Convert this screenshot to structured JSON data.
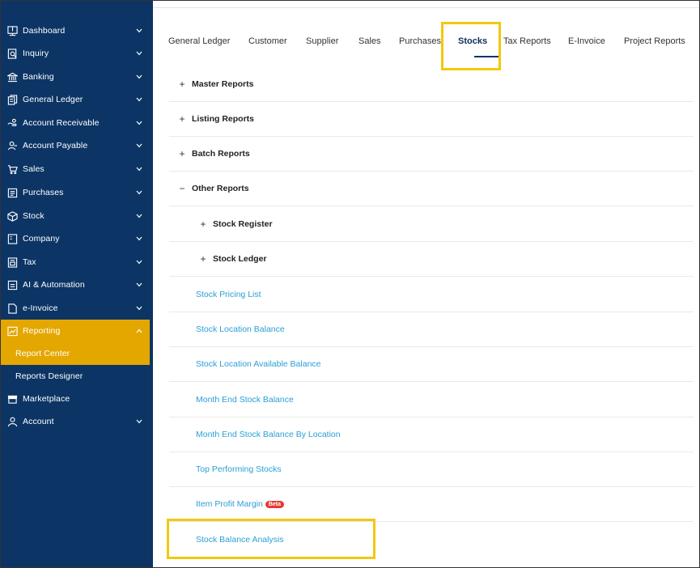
{
  "sidebar": {
    "items": [
      {
        "label": "Dashboard",
        "icon": "dashboard-icon",
        "chevron": true
      },
      {
        "label": "Inquiry",
        "icon": "inquiry-icon",
        "chevron": true
      },
      {
        "label": "Banking",
        "icon": "bank-icon",
        "chevron": true
      },
      {
        "label": "General Ledger",
        "icon": "ledger-icon",
        "chevron": true
      },
      {
        "label": "Account Receivable",
        "icon": "receivable-icon",
        "chevron": true
      },
      {
        "label": "Account Payable",
        "icon": "payable-icon",
        "chevron": true
      },
      {
        "label": "Sales",
        "icon": "cart-icon",
        "chevron": true
      },
      {
        "label": "Purchases",
        "icon": "purchases-icon",
        "chevron": true
      },
      {
        "label": "Stock",
        "icon": "box-icon",
        "chevron": true
      },
      {
        "label": "Company",
        "icon": "company-icon",
        "chevron": true
      },
      {
        "label": "Tax",
        "icon": "tax-icon",
        "chevron": true
      },
      {
        "label": "AI & Automation",
        "icon": "ai-icon",
        "chevron": true
      },
      {
        "label": "e-Invoice",
        "icon": "document-icon",
        "chevron": true
      },
      {
        "label": "Reporting",
        "icon": "chart-icon",
        "chevron": true,
        "expanded": true
      },
      {
        "label": "Report Center",
        "sub": true,
        "active": true
      },
      {
        "label": "Reports Designer",
        "sub": true
      },
      {
        "label": "Marketplace",
        "icon": "store-icon",
        "chevron": false
      },
      {
        "label": "Account",
        "icon": "user-icon",
        "chevron": true
      }
    ]
  },
  "tabs": [
    "General Ledger",
    "Customer",
    "Supplier",
    "Sales",
    "Purchases",
    "Stocks",
    "Tax Reports",
    "E-Invoice",
    "Project Reports"
  ],
  "active_tab": "Stocks",
  "groups": {
    "master": {
      "sign": "+",
      "title": "Master Reports"
    },
    "listing": {
      "sign": "+",
      "title": "Listing Reports"
    },
    "batch": {
      "sign": "+",
      "title": "Batch Reports"
    },
    "other": {
      "sign": "−",
      "title": "Other Reports"
    }
  },
  "subgroups": {
    "register": {
      "sign": "+",
      "title": "Stock Register"
    },
    "ledger": {
      "sign": "+",
      "title": "Stock Ledger"
    }
  },
  "links": [
    "Stock Pricing List",
    "Stock Location Balance",
    "Stock Location Available Balance",
    "Month End Stock Balance",
    "Month End Stock Balance By Location",
    "Top Performing Stocks",
    "Item Profit Margin",
    "Stock Balance Analysis"
  ],
  "beta_label": "Beta",
  "colors": {
    "sidebar": "#0c3565",
    "active": "#e4a700",
    "link": "#2a9fd6",
    "highlight": "#f3c80f"
  }
}
